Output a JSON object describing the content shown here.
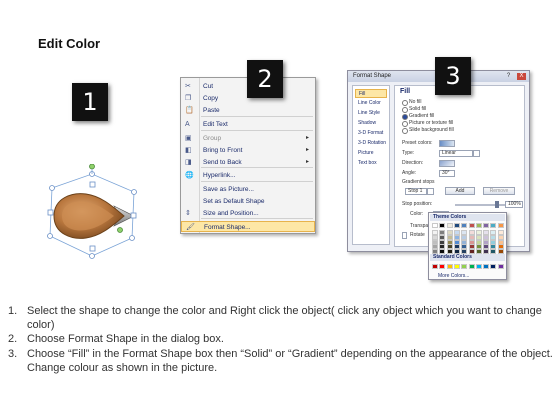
{
  "title": "Edit Color",
  "steps": [
    "1",
    "2",
    "3"
  ],
  "context_menu": {
    "items": [
      {
        "label": "Cut",
        "icon": "scissors-icon",
        "glyph": "✂",
        "submenu": false,
        "disabled": false
      },
      {
        "label": "Copy",
        "icon": "copy-icon",
        "glyph": "❐",
        "submenu": false,
        "disabled": false
      },
      {
        "label": "Paste",
        "icon": "paste-icon",
        "glyph": "📋",
        "submenu": false,
        "disabled": false
      },
      {
        "label": "Edit Text",
        "icon": "edit-text-icon",
        "glyph": "A",
        "submenu": false,
        "disabled": false
      },
      {
        "label": "Group",
        "icon": "group-icon",
        "glyph": "▣",
        "submenu": true,
        "disabled": true
      },
      {
        "label": "Bring to Front",
        "icon": "bring-front-icon",
        "glyph": "◧",
        "submenu": true,
        "disabled": false
      },
      {
        "label": "Send to Back",
        "icon": "send-back-icon",
        "glyph": "◨",
        "submenu": true,
        "disabled": false
      },
      {
        "label": "Hyperlink...",
        "icon": "hyperlink-icon",
        "glyph": "🌐",
        "submenu": false,
        "disabled": false
      },
      {
        "label": "Save as Picture...",
        "icon": "",
        "glyph": "",
        "submenu": false,
        "disabled": false
      },
      {
        "label": "Set as Default Shape",
        "icon": "",
        "glyph": "",
        "submenu": false,
        "disabled": false
      },
      {
        "label": "Size and Position...",
        "icon": "size-position-icon",
        "glyph": "⇕",
        "submenu": false,
        "disabled": false
      },
      {
        "label": "Format Shape...",
        "icon": "format-shape-icon",
        "glyph": "🖌",
        "submenu": false,
        "disabled": false,
        "highlighted": true
      }
    ]
  },
  "dialog": {
    "title": "Format Shape",
    "controls": [
      "?",
      "X"
    ],
    "nav": [
      "Fill",
      "Line Color",
      "Line Style",
      "Shadow",
      "3-D Format",
      "3-D Rotation",
      "Picture",
      "Text box"
    ],
    "selected_nav": "Fill",
    "fill_heading": "Fill",
    "fill_options": [
      {
        "label": "No fill",
        "selected": false
      },
      {
        "label": "Solid fill",
        "selected": false
      },
      {
        "label": "Gradient fill",
        "selected": true
      },
      {
        "label": "Picture or texture fill",
        "selected": false
      },
      {
        "label": "Slide background fill",
        "selected": false
      }
    ],
    "preset_colors_label": "Preset colors:",
    "type_label": "Type:",
    "type_value": "Linear",
    "direction_label": "Direction:",
    "angle_label": "Angle:",
    "angle_value": "30°",
    "gradient_stops_label": "Gradient stops",
    "stop_value": "Stop 1",
    "add_label": "Add",
    "remove_label": "Remove",
    "stop_position_label": "Stop position:",
    "stop_position_value": "100%",
    "color_label": "Color:",
    "transparency_label": "Transpa",
    "rotate_label": "Rotate"
  },
  "palette": {
    "theme_colors_label": "Theme Colors",
    "standard_colors_label": "Standard Colors",
    "more_colors_label": "More Colors...",
    "theme_top": [
      "#ffffff",
      "#000000",
      "#eeece1",
      "#1f497d",
      "#4f81bd",
      "#c0504d",
      "#9bbb59",
      "#8064a2",
      "#4bacc6",
      "#f79646"
    ],
    "theme_shades": [
      [
        "#f2f2f2",
        "#7f7f7f",
        "#ddd9c3",
        "#c6d9f0",
        "#dbe5f1",
        "#f2dcdb",
        "#ebf1dd",
        "#e5e0ec",
        "#dbeef3",
        "#fdeada"
      ],
      [
        "#d8d8d8",
        "#595959",
        "#c4bd97",
        "#8db3e2",
        "#b8cce4",
        "#e5b9b7",
        "#d7e3bc",
        "#ccc1d9",
        "#b7dde8",
        "#fbd5b5"
      ],
      [
        "#bfbfbf",
        "#3f3f3f",
        "#938953",
        "#548dd4",
        "#95b3d7",
        "#d99694",
        "#c3d69b",
        "#b2a2c7",
        "#92cddc",
        "#fac08f"
      ],
      [
        "#a5a5a5",
        "#262626",
        "#494429",
        "#17365d",
        "#366092",
        "#953734",
        "#76923c",
        "#5f497a",
        "#31859b",
        "#e36c09"
      ],
      [
        "#7f7f7f",
        "#0c0c0c",
        "#1d1b10",
        "#0f243e",
        "#244061",
        "#632423",
        "#4f6128",
        "#3f3151",
        "#205867",
        "#974806"
      ]
    ],
    "standard": [
      "#c00000",
      "#ff0000",
      "#ffc000",
      "#ffff00",
      "#92d050",
      "#00b050",
      "#00b0f0",
      "#0070c0",
      "#002060",
      "#7030a0"
    ]
  },
  "shape": {
    "fill_color": "#b9773e",
    "arrow_color": "#9a9a9a",
    "handle_color": "#8fd06a"
  },
  "instructions": [
    {
      "num": "1.",
      "text": "Select the shape to change the color and Right click the object( click any object which you want to change color)"
    },
    {
      "num": "2.",
      "text": "Choose Format Shape in the dialog box."
    },
    {
      "num": "3.",
      "text": "Choose “Fill” in the Format Shape box then “Solid” or “Gradient” depending on the appearance of the object. Change colour as shown in the picture."
    }
  ]
}
